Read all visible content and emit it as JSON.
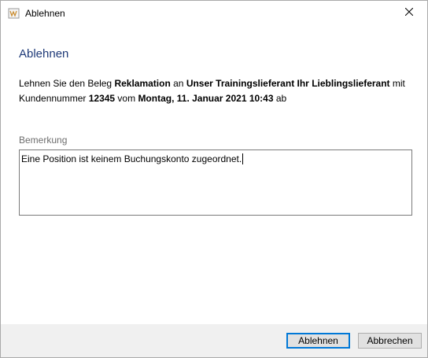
{
  "window": {
    "title": "Ablehnen",
    "icon": "app-icon",
    "close_icon": "close-icon"
  },
  "dialog": {
    "heading": "Ablehnen",
    "message": {
      "part1": "Lehnen Sie den Beleg ",
      "document": "Reklamation",
      "part2": " an ",
      "recipient": "Unser Trainingslieferant Ihr Lieblingslieferant",
      "part3": " mit",
      "part4": "Kundennummer ",
      "customer_number": "12345",
      "part5": " vom ",
      "date": "Montag, 11. Januar 2021 10:43",
      "part6": " ab"
    },
    "remark": {
      "label": "Bemerkung",
      "value": "Eine Position ist keinem Buchungskonto zugeordnet."
    }
  },
  "buttons": {
    "reject": "Ablehnen",
    "cancel": "Abbrechen"
  },
  "colors": {
    "heading": "#1f3a78",
    "accent": "#0078d7",
    "footer": "#f0f0f0"
  }
}
